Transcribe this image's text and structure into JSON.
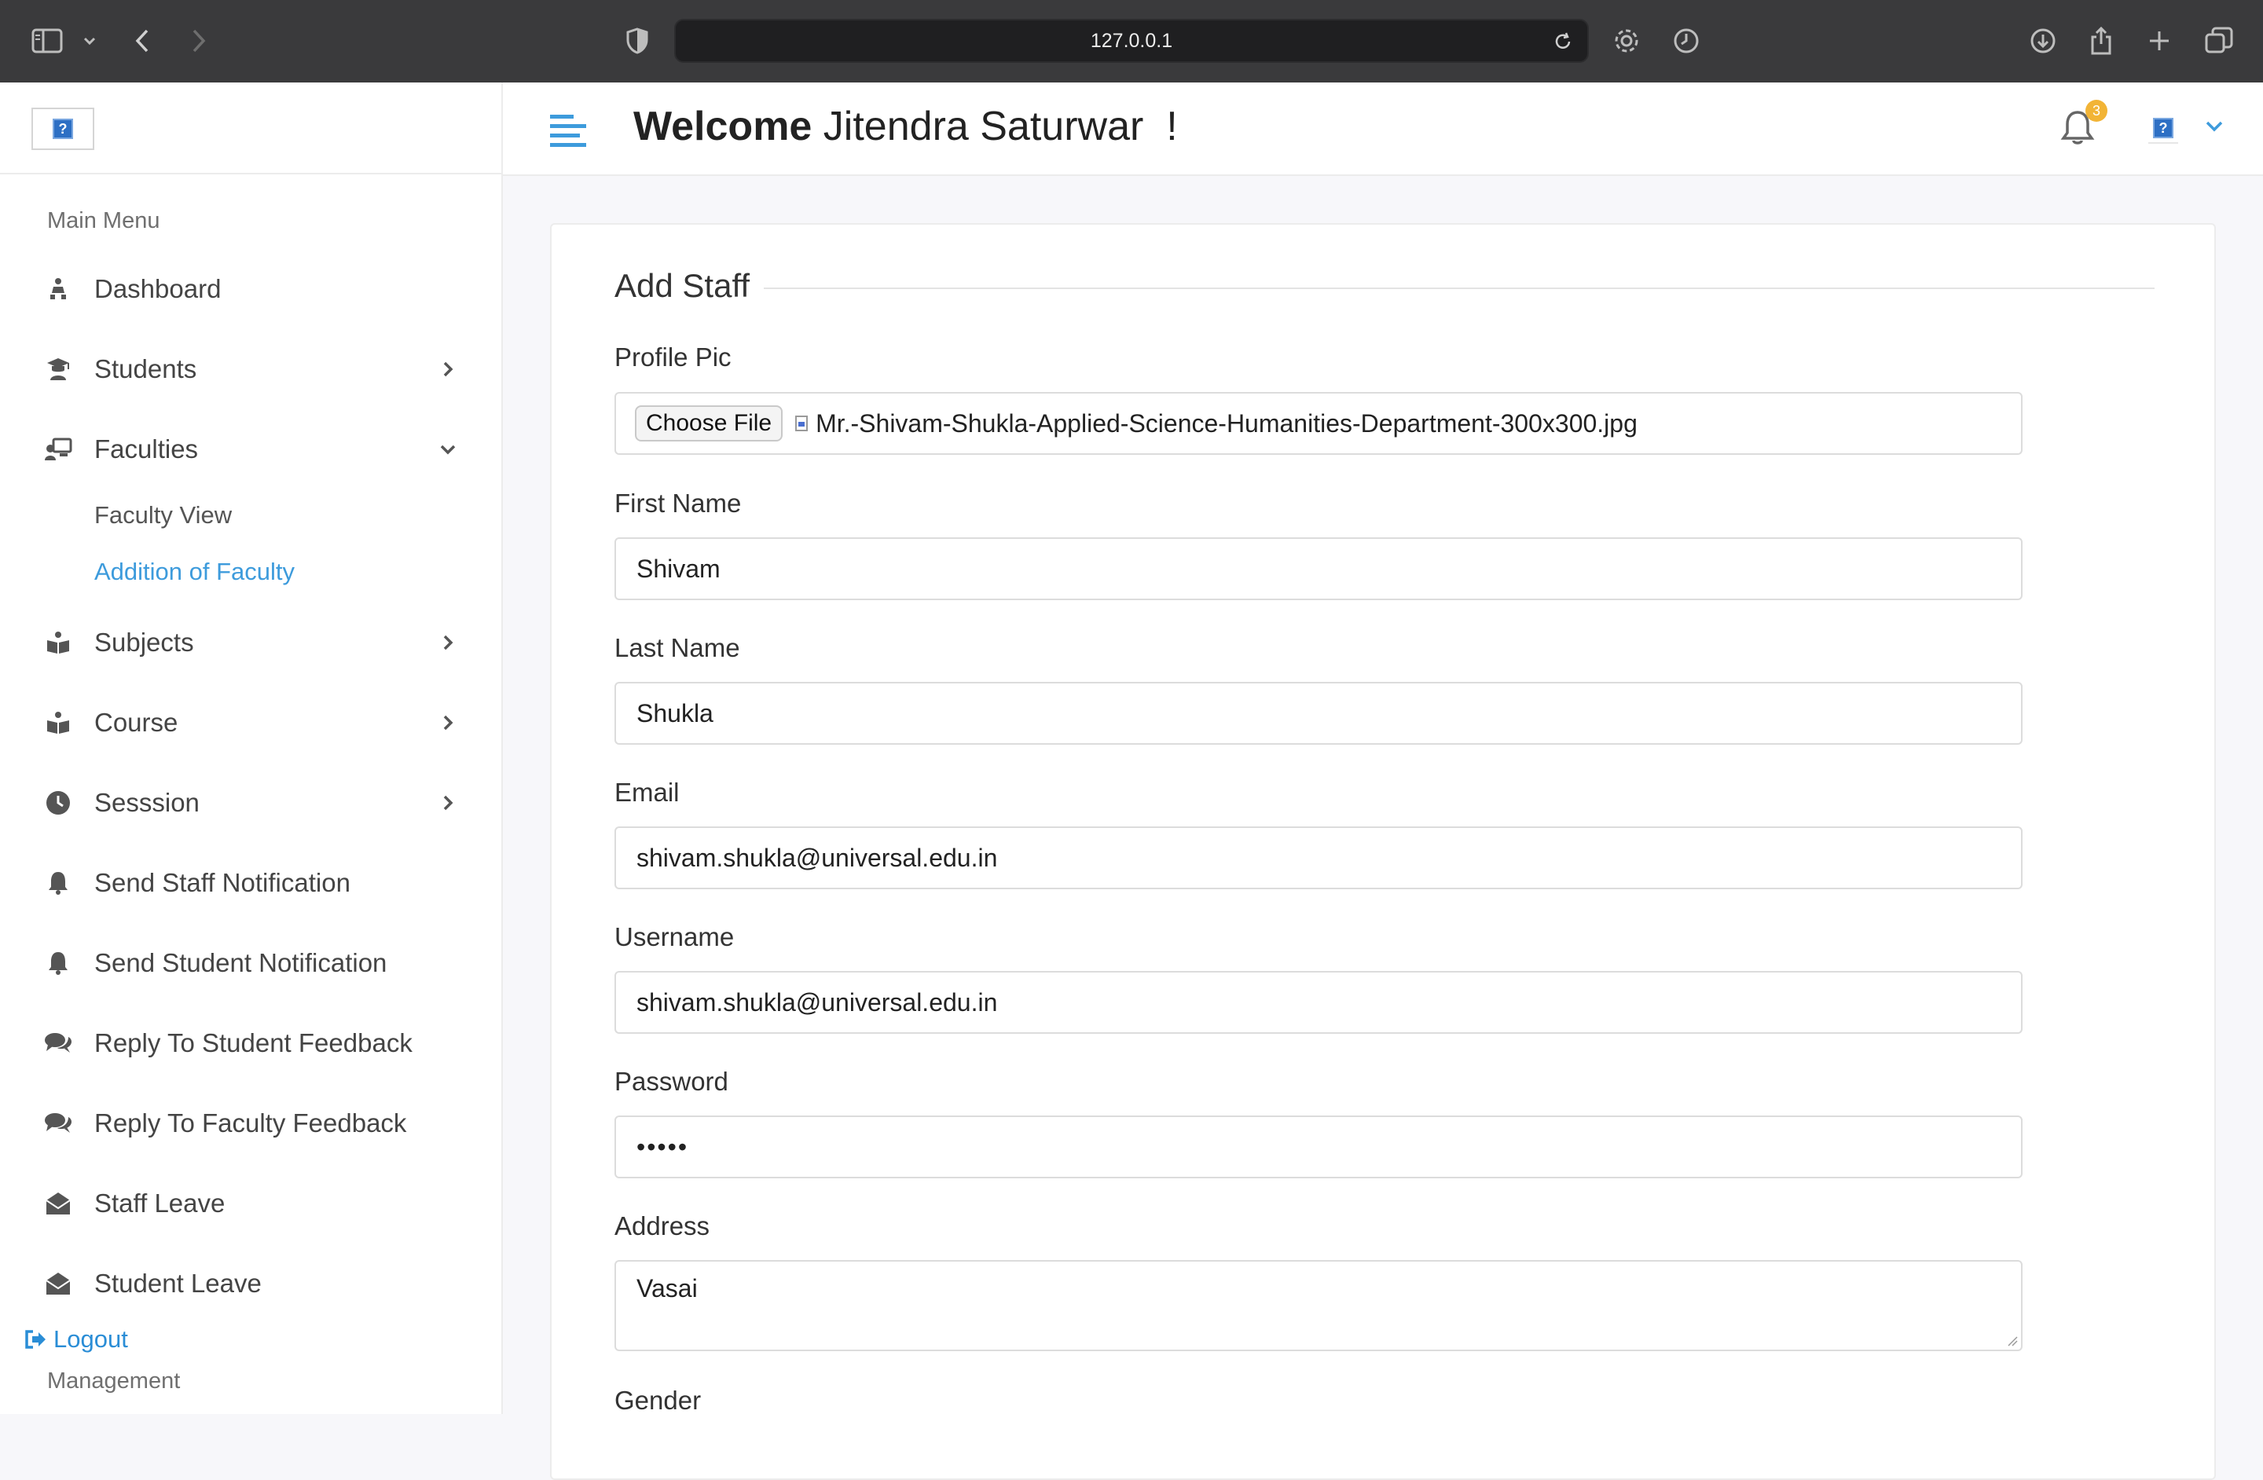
{
  "browser": {
    "url": "127.0.0.1"
  },
  "sidebar": {
    "logo_alt": "?",
    "section_title": "Main Menu",
    "items": [
      {
        "label": "Dashboard",
        "icon": "dashboard-icon"
      },
      {
        "label": "Students",
        "icon": "student-icon"
      },
      {
        "label": "Faculties",
        "icon": "faculty-icon"
      },
      {
        "label": "Subjects",
        "icon": "book-icon"
      },
      {
        "label": "Course",
        "icon": "book-icon"
      },
      {
        "label": "Sesssion",
        "icon": "clock-icon"
      },
      {
        "label": "Send Staff Notification",
        "icon": "bell-icon"
      },
      {
        "label": "Send Student Notification",
        "icon": "bell-icon"
      },
      {
        "label": "Reply To Student Feedback",
        "icon": "comments-icon"
      },
      {
        "label": "Reply To Faculty Feedback",
        "icon": "comments-icon"
      },
      {
        "label": "Staff Leave",
        "icon": "envelope-open-icon"
      },
      {
        "label": "Student Leave",
        "icon": "envelope-open-icon"
      }
    ],
    "faculty_sub": {
      "view": "Faculty View",
      "add": "Addition of Faculty"
    },
    "logout": "Logout",
    "management": "Management"
  },
  "header": {
    "welcome_bold": "Welcome",
    "user_name": " Jitendra Saturwar  !",
    "notification_count": "3",
    "avatar_alt": "?"
  },
  "form": {
    "title": "Add Staff",
    "profile_pic": {
      "label": "Profile Pic",
      "button": "Choose File",
      "file_name": "Mr.-Shivam-Shukla-Applied-Science-Humanities-Department-300x300.jpg"
    },
    "first_name": {
      "label": "First Name",
      "value": "Shivam"
    },
    "last_name": {
      "label": "Last Name",
      "value": "Shukla"
    },
    "email": {
      "label": "Email",
      "value": "shivam.shukla@universal.edu.in"
    },
    "username": {
      "label": "Username",
      "value": "shivam.shukla@universal.edu.in"
    },
    "password": {
      "label": "Password",
      "value": "•••••"
    },
    "address": {
      "label": "Address",
      "value": "Vasai"
    },
    "gender": {
      "label": "Gender"
    }
  },
  "colors": {
    "accent": "#3d9bdc",
    "badge": "#f2b436",
    "chrome": "#3a3a3c"
  }
}
